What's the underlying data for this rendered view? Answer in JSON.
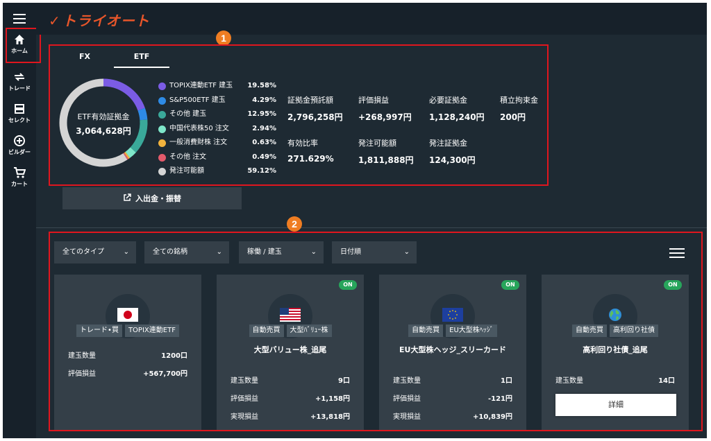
{
  "app": {
    "logo_text": "トライオート",
    "brand_color": "#e8562a"
  },
  "nav": {
    "items": [
      {
        "label": "ホーム",
        "icon": "home-icon"
      },
      {
        "label": "トレード",
        "icon": "trade-icon"
      },
      {
        "label": "セレクト",
        "icon": "select-icon"
      },
      {
        "label": "ビルダー",
        "icon": "builder-icon"
      },
      {
        "label": "カート",
        "icon": "cart-icon"
      }
    ]
  },
  "callouts": {
    "one": "1",
    "two": "2"
  },
  "summary": {
    "tabs": [
      "FX",
      "ETF"
    ],
    "active_tab": "ETF",
    "donut_label": "ETF有効証拠金",
    "donut_value": "3,064,628円",
    "legend": [
      {
        "name": "TOPIX連動ETF 建玉",
        "pct": "19.58%",
        "value": 19.58,
        "color": "#7b5ce5"
      },
      {
        "name": "S&P500ETF 建玉",
        "pct": "4.29%",
        "value": 4.29,
        "color": "#2e8be6"
      },
      {
        "name": "その他 建玉",
        "pct": "12.95%",
        "value": 12.95,
        "color": "#3aa99a"
      },
      {
        "name": "中国代表株50 注文",
        "pct": "2.94%",
        "value": 2.94,
        "color": "#7ee6c9"
      },
      {
        "name": "一般消費財株 注文",
        "pct": "0.63%",
        "value": 0.63,
        "color": "#f2b33d"
      },
      {
        "name": "その他 注文",
        "pct": "0.49%",
        "value": 0.49,
        "color": "#e35a6b"
      },
      {
        "name": "発注可能額",
        "pct": "59.12%",
        "value": 59.12,
        "color": "#d4d4d4"
      }
    ],
    "metrics": [
      {
        "label": "証拠金預託額",
        "value": "2,796,258円"
      },
      {
        "label": "評価損益",
        "value": "+268,997円"
      },
      {
        "label": "必要証拠金",
        "value": "1,128,240円"
      },
      {
        "label": "積立拘束金",
        "value": "200円"
      },
      {
        "label": "有効比率",
        "value": "271.629%"
      },
      {
        "label": "発注可能額",
        "value": "1,811,888円"
      },
      {
        "label": "発注証拠金",
        "value": "124,300円"
      }
    ],
    "deposit_button": "入出金・振替"
  },
  "filters": [
    {
      "label": "全てのタイプ"
    },
    {
      "label": "全ての銘柄"
    },
    {
      "label": "稼働 / 建玉"
    },
    {
      "label": "日付順"
    }
  ],
  "cards": [
    {
      "on": "",
      "icon": "japan-flag-icon",
      "tags": [
        "トレード•買",
        "TOPIX連動ETF"
      ],
      "title": "",
      "rows": [
        {
          "label": "建玉数量",
          "value": "1200口"
        },
        {
          "label": "評価損益",
          "value": "+567,700円"
        }
      ]
    },
    {
      "on": "ON",
      "icon": "us-flag-icon",
      "tags": [
        "自動売買",
        "大型ﾊﾞﾘｭｰ株"
      ],
      "title": "大型バリュー株_追尾",
      "rows": [
        {
          "label": "建玉数量",
          "value": "9口"
        },
        {
          "label": "評価損益",
          "value": "+1,158円"
        },
        {
          "label": "実現損益",
          "value": "+13,818円"
        }
      ]
    },
    {
      "on": "ON",
      "icon": "eu-flag-icon",
      "tags": [
        "自動売買",
        "EU大型株ﾍｯｼﾞ"
      ],
      "title": "EU大型株ヘッジ_スリーカード",
      "rows": [
        {
          "label": "建玉数量",
          "value": "1口"
        },
        {
          "label": "評価損益",
          "value": "-121円"
        },
        {
          "label": "実現損益",
          "value": "+10,839円"
        }
      ]
    },
    {
      "on": "ON",
      "icon": "globe-icon",
      "tags": [
        "自動売買",
        "高利回り社債"
      ],
      "title": "高利回り社債_追尾",
      "rows": [
        {
          "label": "建玉数量",
          "value": "14口"
        }
      ],
      "detail_button": "詳細"
    }
  ]
}
